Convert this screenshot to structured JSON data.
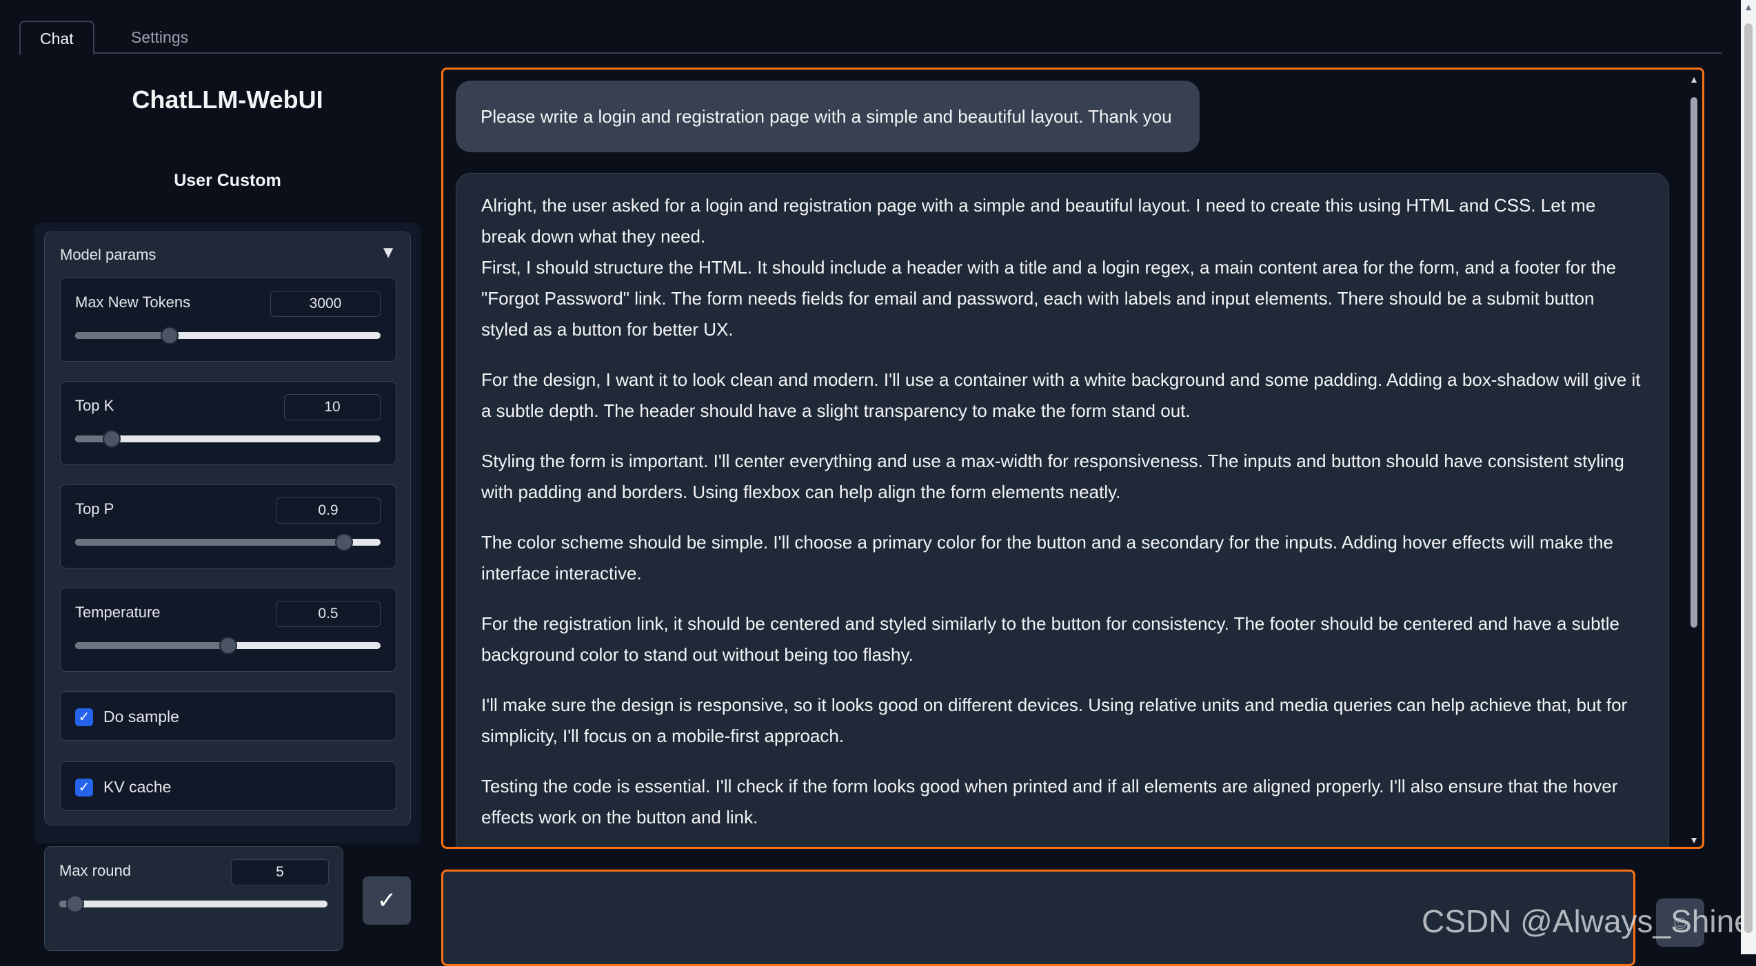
{
  "tabs": [
    {
      "label": "Chat",
      "active": true
    },
    {
      "label": "Settings",
      "active": false
    }
  ],
  "sidebar": {
    "app_title": "ChatLLM-WebUI",
    "section_title": "User Custom",
    "accordion": {
      "title": "Model params",
      "toggle_icon": "▼",
      "params": [
        {
          "label": "Max New Tokens",
          "value": "3000",
          "fraction": 0.31
        },
        {
          "label": "Top K",
          "value": "10",
          "fraction": 0.12
        },
        {
          "label": "Top P",
          "value": "0.9",
          "fraction": 0.88
        },
        {
          "label": "Temperature",
          "value": "0.5",
          "fraction": 0.5
        }
      ],
      "checkboxes": [
        {
          "label": "Do sample",
          "checked": true
        },
        {
          "label": "KV cache",
          "checked": true
        }
      ]
    },
    "max_round": {
      "label": "Max round",
      "value": "5",
      "fraction": 0.06
    },
    "submit_icon": "✓"
  },
  "chat": {
    "user_message": "Please write a login and registration page with a simple and beautiful layout. Thank you",
    "bot_paragraphs": [
      "Alright, the user asked for a login and registration page with a simple and beautiful layout. I need to create this using HTML and CSS. Let me break down what they need.\nFirst, I should structure the HTML. It should include a header with a title and a login regex, a main content area for the form, and a footer for the \"Forgot Password\" link. The form needs fields for email and password, each with labels and input elements. There should be a submit button styled as a button for better UX.",
      "For the design, I want it to look clean and modern. I'll use a container with a white background and some padding. Adding a box-shadow will give it a subtle depth. The header should have a slight transparency to make the form stand out.",
      "Styling the form is important. I'll center everything and use a max-width for responsiveness. The inputs and button should have consistent styling with padding and borders. Using flexbox can help align the form elements neatly.",
      "The color scheme should be simple. I'll choose a primary color for the button and a secondary for the inputs. Adding hover effects will make the interface interactive.",
      "For the registration link, it should be centered and styled similarly to the button for consistency. The footer should be centered and have a subtle background color to stand out without being too flashy.",
      "I'll make sure the design is responsive, so it looks good on different devices. Using relative units and media queries can help achieve that, but for simplicity, I'll focus on a mobile-first approach.",
      "Testing the code is essential. I'll check if the form looks good when printed and if all elements are aligned properly. I'll also ensure that the hover effects work on the button and link."
    ],
    "scroll_up_icon": "▲",
    "scroll_down_icon": "▼"
  },
  "input": {
    "placeholder": "",
    "emoji_icon": "☺"
  },
  "watermark": "CSDN @Always_Shine",
  "colors": {
    "background": "#0b0f19",
    "panel": "#1f2937",
    "accent_border": "#f97316",
    "checkbox": "#2563eb"
  }
}
